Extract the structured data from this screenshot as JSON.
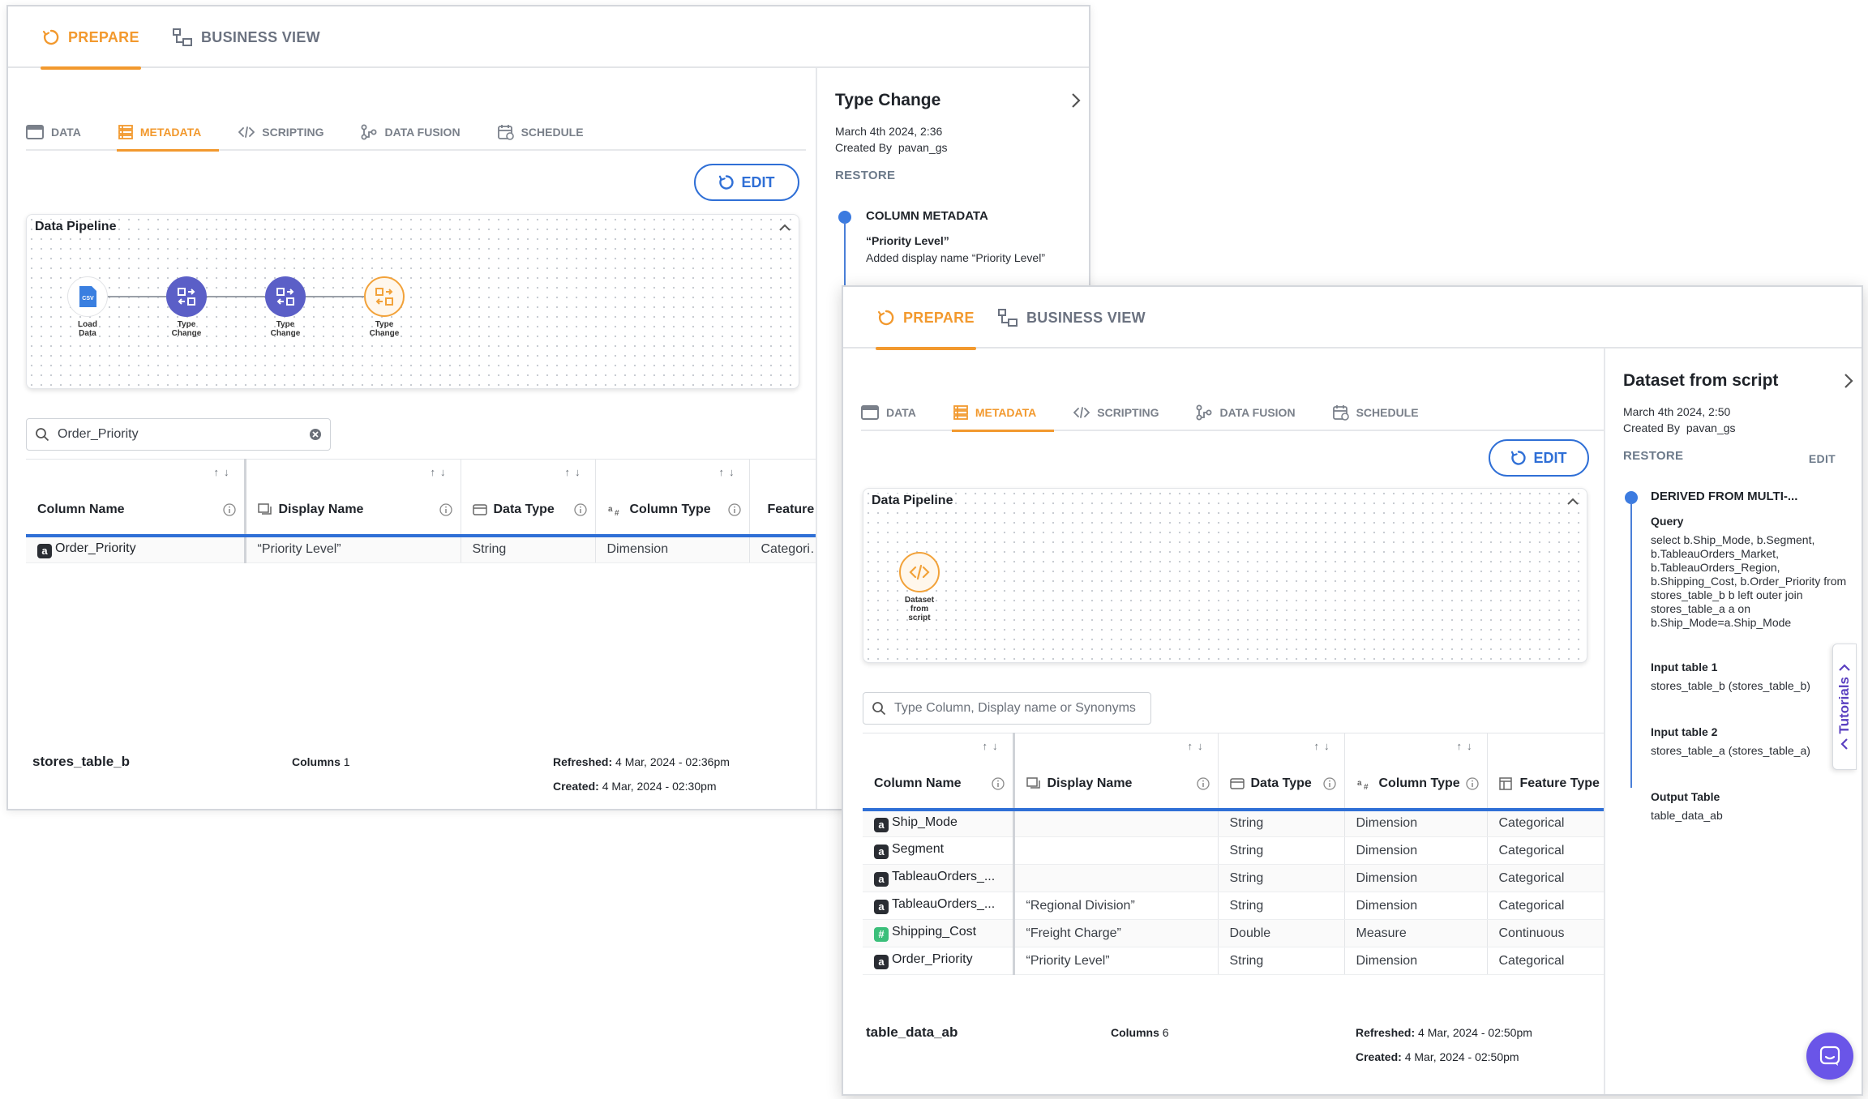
{
  "colors": {
    "accent_orange": "#f2992e",
    "primary_blue": "#2f6fd6",
    "node_purple": "#5b5fc7",
    "chat_purple": "#6a55e8"
  },
  "window1": {
    "toptabs": {
      "prepare": "PREPARE",
      "business_view": "BUSINESS VIEW"
    },
    "subtabs": [
      "DATA",
      "METADATA",
      "SCRIPTING",
      "DATA FUSION",
      "SCHEDULE"
    ],
    "edit_label": "EDIT",
    "pipeline": {
      "title": "Data Pipeline",
      "nodes": [
        {
          "label_lines": [
            "Load",
            "Data"
          ],
          "icon": "csv-file-icon"
        },
        {
          "label_lines": [
            "Type",
            "Change"
          ],
          "icon": "type-change-icon"
        },
        {
          "label_lines": [
            "Type",
            "Change"
          ],
          "icon": "type-change-icon"
        },
        {
          "label_lines": [
            "Type",
            "Change"
          ],
          "icon": "type-change-icon"
        }
      ],
      "csv_text": "CSV"
    },
    "search": {
      "value": "Order_Priority"
    },
    "table": {
      "columns": [
        "Column Name",
        "Display Name",
        "Data Type",
        "Column Type",
        "Feature Type"
      ],
      "rows": [
        {
          "type": "a",
          "name": "Order_Priority",
          "display": "“Priority Level”",
          "data_type": "String",
          "column_type": "Dimension",
          "feature_type": "Categorical"
        }
      ]
    },
    "footer": {
      "table_name": "stores_table_b",
      "columns_label": "Columns",
      "columns_count": "1",
      "refreshed_label": "Refreshed",
      "refreshed_value": "4 Mar, 2024 - 02:36pm",
      "created_label": "Created",
      "created_value": "4 Mar, 2024 - 02:30pm"
    },
    "history": {
      "title": "Type Change",
      "date": "March 4th 2024, 2:36",
      "created_by_label": "Created By",
      "created_by": "pavan_gs",
      "restore": "RESTORE",
      "event_title": "COLUMN METADATA",
      "event_subject": "“Priority Level”",
      "event_desc": "Added display name “Priority Level”"
    }
  },
  "window2": {
    "toptabs": {
      "prepare": "PREPARE",
      "business_view": "BUSINESS VIEW"
    },
    "subtabs": [
      "DATA",
      "METADATA",
      "SCRIPTING",
      "DATA FUSION",
      "SCHEDULE"
    ],
    "edit_label": "EDIT",
    "pipeline": {
      "title": "Data Pipeline",
      "nodes": [
        {
          "label_lines": [
            "Dataset",
            "from",
            "script"
          ],
          "icon": "code-icon"
        }
      ]
    },
    "search": {
      "placeholder": "Type Column, Display name or Synonyms"
    },
    "table": {
      "columns": [
        "Column Name",
        "Display Name",
        "Data Type",
        "Column Type",
        "Feature Type"
      ],
      "rows": [
        {
          "type": "a",
          "name": "Ship_Mode",
          "display": "",
          "data_type": "String",
          "column_type": "Dimension",
          "feature_type": "Categorical"
        },
        {
          "type": "a",
          "name": "Segment",
          "display": "",
          "data_type": "String",
          "column_type": "Dimension",
          "feature_type": "Categorical"
        },
        {
          "type": "a",
          "name": "TableauOrders_...",
          "display": "",
          "data_type": "String",
          "column_type": "Dimension",
          "feature_type": "Categorical"
        },
        {
          "type": "a",
          "name": "TableauOrders_...",
          "display": "“Regional Division”",
          "data_type": "String",
          "column_type": "Dimension",
          "feature_type": "Categorical"
        },
        {
          "type": "#",
          "name": "Shipping_Cost",
          "display": "“Freight Charge”",
          "data_type": "Double",
          "column_type": "Measure",
          "feature_type": "Continuous"
        },
        {
          "type": "a",
          "name": "Order_Priority",
          "display": "“Priority Level”",
          "data_type": "String",
          "column_type": "Dimension",
          "feature_type": "Categorical"
        }
      ]
    },
    "footer": {
      "table_name": "table_data_ab",
      "columns_label": "Columns",
      "columns_count": "6",
      "refreshed_label": "Refreshed",
      "refreshed_value": "4 Mar, 2024 - 02:50pm",
      "created_label": "Created",
      "created_value": "4 Mar, 2024 - 02:50pm"
    },
    "history": {
      "title": "Dataset from script",
      "date": "March 4th 2024, 2:50",
      "created_by_label": "Created By",
      "created_by": "pavan_gs",
      "restore": "RESTORE",
      "edit": "EDIT",
      "event_title": "DERIVED FROM MULTI-...",
      "query_label": "Query",
      "query_lines": [
        "select b.Ship_Mode, b.Segment,",
        "b.TableauOrders_Market,",
        "b.TableauOrders_Region,",
        "b.Shipping_Cost, b.Order_Priority from",
        "stores_table_b b left outer join",
        "stores_table_a a on",
        "b.Ship_Mode=a.Ship_Mode"
      ],
      "input1_label": "Input table 1",
      "input1_value": "stores_table_b (stores_table_b)",
      "input2_label": "Input table 2",
      "input2_value": "stores_table_a (stores_table_a)",
      "output_label": "Output Table",
      "output_value": "table_data_ab"
    },
    "tutorials_label": "Tutorials"
  }
}
